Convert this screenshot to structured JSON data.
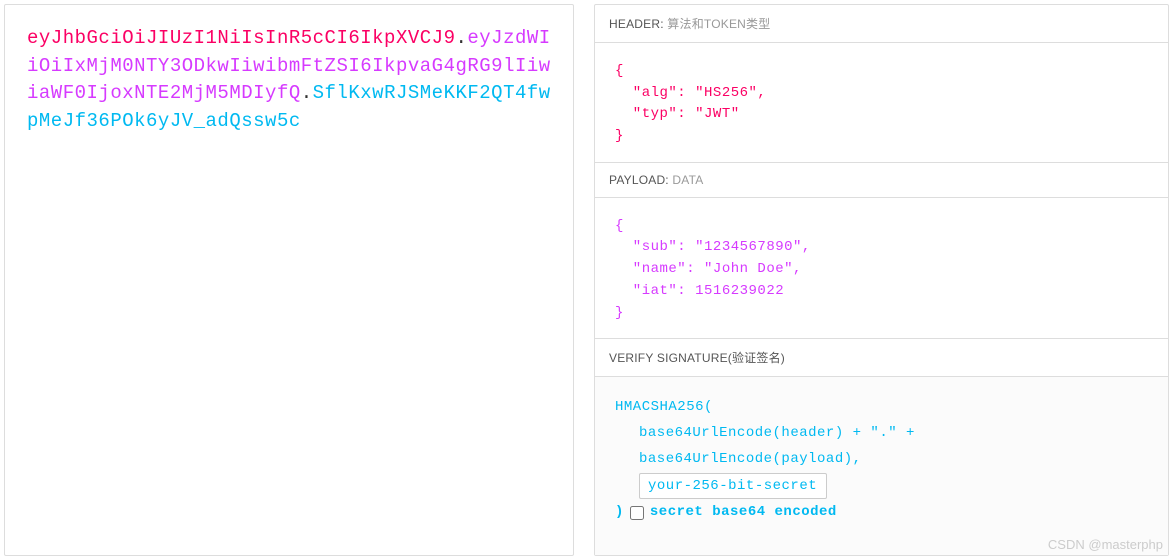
{
  "encoded": {
    "header": "eyJhbGciOiJIUzI1NiIsInR5cCI6IkpXVCJ9",
    "payload": "eyJzdWIiOiIxMjM0NTY3ODkwIiwibmFtZSI6IkpvaG4gRG9lIiwiaWF0IjoxNTE2MjM5MDIyfQ",
    "signature": "SflKxwRJSMeKKF2QT4fwpMeJf36POk6yJV_adQssw5c"
  },
  "sections": {
    "header": {
      "title_prefix": "HEADER:",
      "title_sub": "算法和TOKEN类型",
      "json": "{\n  \"alg\": \"HS256\",\n  \"typ\": \"JWT\"\n}"
    },
    "payload": {
      "title_prefix": "PAYLOAD:",
      "title_sub": "DATA",
      "json": "{\n  \"sub\": \"1234567890\",\n  \"name\": \"John Doe\",\n  \"iat\": 1516239022\n}"
    },
    "verify": {
      "title": "VERIFY SIGNATURE(验证签名)",
      "line1": "HMACSHA256(",
      "line2": "base64UrlEncode(header) + \".\" +",
      "line3": "base64UrlEncode(payload),",
      "secret_placeholder": "your-256-bit-secret",
      "line4_prefix": ")",
      "checkbox_label": "secret base64 encoded"
    }
  },
  "watermark": "CSDN @masterphp",
  "colors": {
    "header": "#fb0064",
    "payload": "#d63aff",
    "signature": "#00b9f1"
  }
}
